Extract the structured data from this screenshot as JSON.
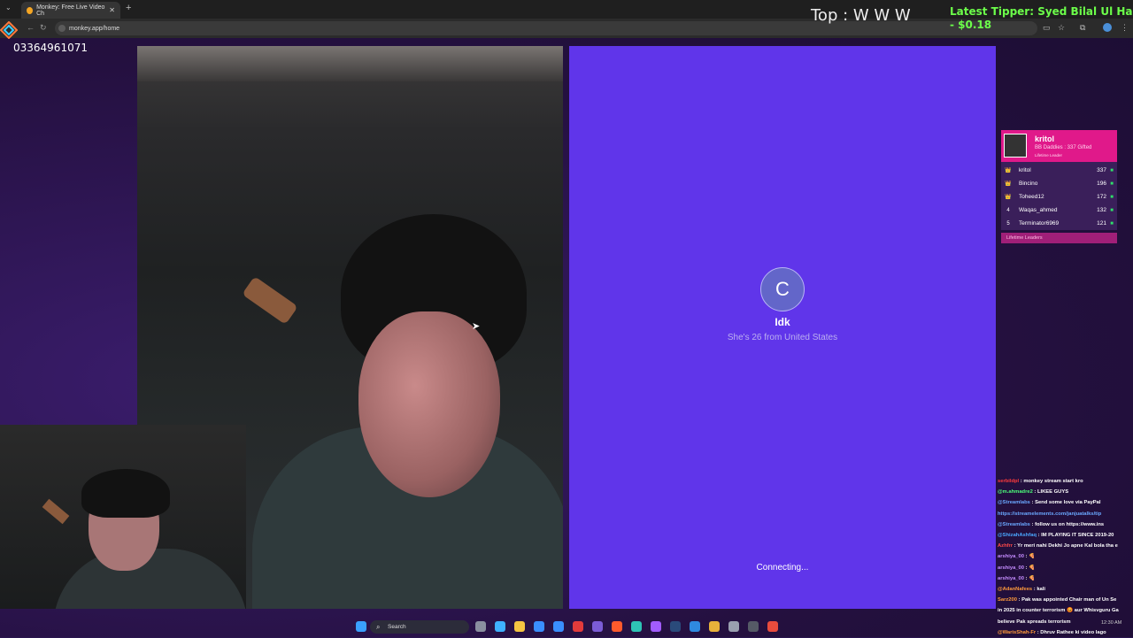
{
  "browser": {
    "tab_title": "Monkey: Free Live Video Ch",
    "tab_close": "✕",
    "new_tab": "+",
    "url": "monkey.app/home",
    "back_icon": "back-icon",
    "reload_icon": "reload-icon"
  },
  "stream_overlay": {
    "phone": "03364961071",
    "top_label": "Top : W W W",
    "tipper_line1": "Latest Tipper: Syed Bilal Ul Hass",
    "tipper_line2": "- $0.18"
  },
  "match": {
    "avatar_letter": "C",
    "name": "Idk",
    "bio": "She's 26 from United States",
    "status": "Connecting..."
  },
  "leaderboard": {
    "leader_name": "kritol",
    "leader_sub": "BB Daddies : 337 Gifted",
    "leader_sub2": "Lifetime Leader",
    "rows": [
      {
        "rank": "👑",
        "user": "kritol",
        "count": "337",
        "rank_color": "#f5c542"
      },
      {
        "rank": "👑",
        "user": "Bincino",
        "count": "196",
        "rank_color": "#c0c8d8"
      },
      {
        "rank": "👑",
        "user": "Toheed12",
        "count": "172",
        "rank_color": "#d08a3c"
      },
      {
        "rank": "4",
        "user": "Waqas_ahmed",
        "count": "132",
        "rank_color": "#ffffff"
      },
      {
        "rank": "5",
        "user": "Terminator6969",
        "count": "121",
        "rank_color": "#ffffff"
      }
    ],
    "footer": "Lifetime Leaders"
  },
  "chat": [
    {
      "user": "serbildpl",
      "msg": ": monkey stream start kro",
      "color": "#ff3b3b"
    },
    {
      "user": "@m.ahmadre2",
      "msg": ": LIKEE GUYS",
      "color": "#4cff7a"
    },
    {
      "user": "@Streamlabs",
      "msg": ": Send some love via PayPal",
      "color": "#6aa8ff"
    },
    {
      "user": "",
      "msg": "https://streamelements.com/janjuatalks/tip",
      "color": "#6aa8ff"
    },
    {
      "user": "@Streamlabs",
      "msg": ": follow us on https://www.ins",
      "color": "#6aa8ff"
    },
    {
      "user": "@ShizahAshfaq",
      "msg": ": IM PLAYING IT SINCE 2019-20",
      "color": "#4aa8ff"
    },
    {
      "user": "Azhfrr",
      "msg": ": Yr meri nahi Dekhi Jo apne Kal bola tha e",
      "color": "#ff4a4a"
    },
    {
      "user": "arshiya_00",
      "msg": ": 🍕",
      "color": "#c58cff"
    },
    {
      "user": "arshiya_00",
      "msg": ": 🍕",
      "color": "#c58cff"
    },
    {
      "user": "arshiya_00",
      "msg": ": 🍕",
      "color": "#c58cff"
    },
    {
      "user": "@AdanNafees",
      "msg": ": kali",
      "color": "#ff9a3c"
    },
    {
      "user": "Sarz200",
      "msg": ": Pak was appointed Chair man of Un Se",
      "color": "#ff9a3c"
    },
    {
      "user": "",
      "msg": "in 2025 in counter terrorism 😡 aur Whisvguru Ga",
      "color": "#ffffff"
    },
    {
      "user": "",
      "msg": "believe Pak spreads terrorism",
      "color": "#ffffff"
    },
    {
      "user": "@WarisShah-Fr",
      "msg": ": Dhruv Rathee ki video lago",
      "color": "#ff9a3c"
    }
  ],
  "taskbar": {
    "search_label": "Search",
    "time": "12:30 AM",
    "icons": [
      {
        "name": "start-icon",
        "color": "#3aa0ff"
      },
      {
        "name": "task-view-icon",
        "color": "#8a8fa0"
      },
      {
        "name": "copilot-icon",
        "color": "#3fb1ff"
      },
      {
        "name": "file-explorer-icon",
        "color": "#f5c542"
      },
      {
        "name": "store-icon",
        "color": "#3a8fff"
      },
      {
        "name": "mail-icon",
        "color": "#3a8fff"
      },
      {
        "name": "app-red-icon",
        "color": "#e23b3b"
      },
      {
        "name": "teams-icon",
        "color": "#7b5cd6"
      },
      {
        "name": "brave-icon",
        "color": "#ff5a2c"
      },
      {
        "name": "edge-icon",
        "color": "#2ec4b6"
      },
      {
        "name": "messenger-icon",
        "color": "#a25cff"
      },
      {
        "name": "steam-icon",
        "color": "#2a4a7a"
      },
      {
        "name": "vscode-icon",
        "color": "#2f8ae0"
      },
      {
        "name": "chrome-icon",
        "color": "#e8b13a"
      },
      {
        "name": "app-gray-icon",
        "color": "#9aa0b0"
      },
      {
        "name": "app-dark-icon",
        "color": "#555a66"
      },
      {
        "name": "chrome-active-icon",
        "color": "#e84c3d"
      }
    ]
  }
}
